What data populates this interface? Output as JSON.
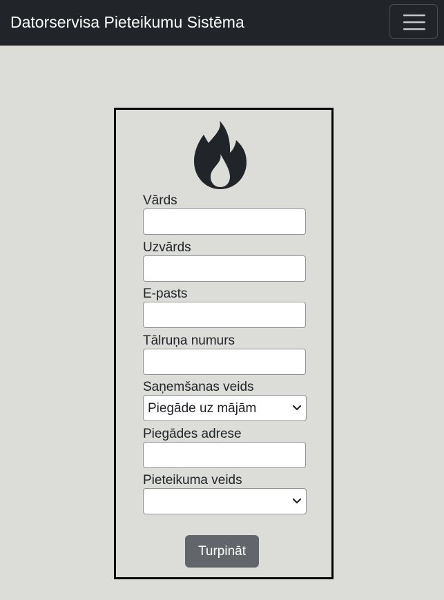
{
  "navbar": {
    "brand": "Datorservisa Pieteikumu Sistēma",
    "toggler_icon": "hamburger-icon"
  },
  "form": {
    "logo_icon": "fire-icon",
    "fields": {
      "first_name": {
        "label": "Vārds",
        "value": ""
      },
      "last_name": {
        "label": "Uzvārds",
        "value": ""
      },
      "email": {
        "label": "E-pasts",
        "value": ""
      },
      "phone": {
        "label": "Tālruņa numurs",
        "value": ""
      },
      "receive_method": {
        "label": "Saņemšanas veids",
        "selected": "Piegāde uz mājām"
      },
      "delivery_address": {
        "label": "Piegādes adrese",
        "value": ""
      },
      "request_type": {
        "label": "Pieteikuma veids",
        "selected": ""
      }
    },
    "submit_label": "Turpināt"
  },
  "colors": {
    "navbar_bg": "#212529",
    "page_bg": "#dcdcd8",
    "button_bg": "#62666a",
    "icon": "#212529"
  }
}
